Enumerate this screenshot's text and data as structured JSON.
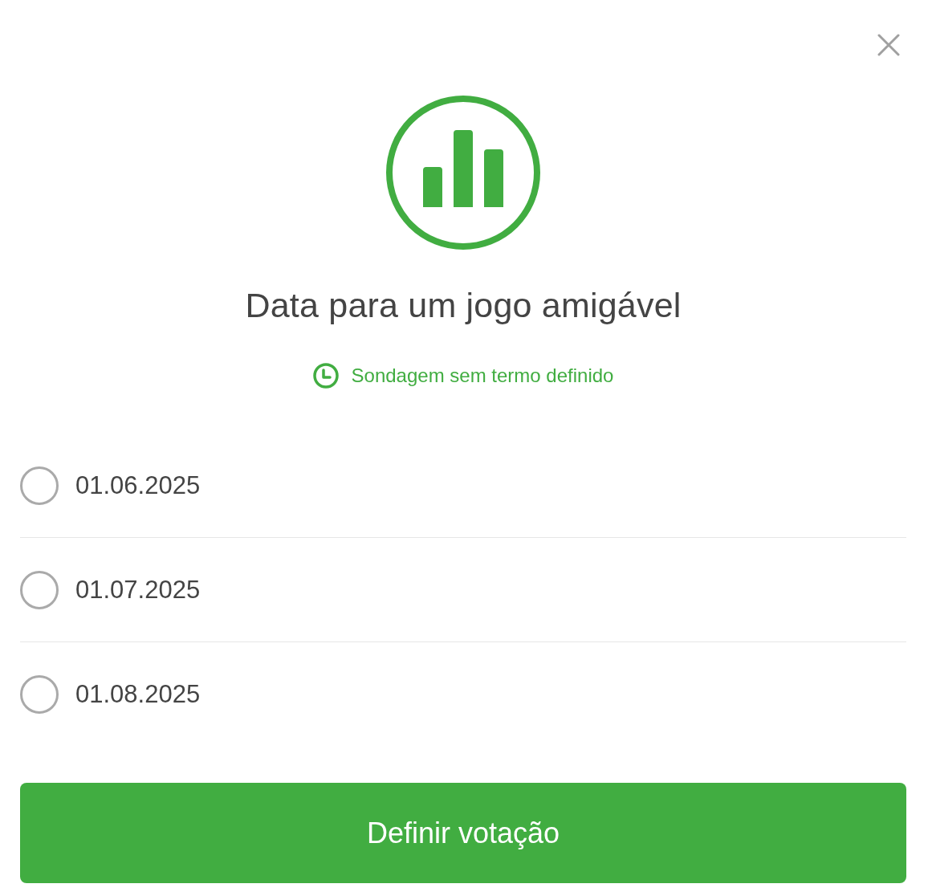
{
  "title": "Data para um jogo amigável",
  "deadline": {
    "text": "Sondagem sem termo definido"
  },
  "options": [
    {
      "label": "01.06.2025",
      "selected": false
    },
    {
      "label": "01.07.2025",
      "selected": false
    },
    {
      "label": "01.08.2025",
      "selected": false
    }
  ],
  "submit": {
    "label": "Definir votação"
  }
}
